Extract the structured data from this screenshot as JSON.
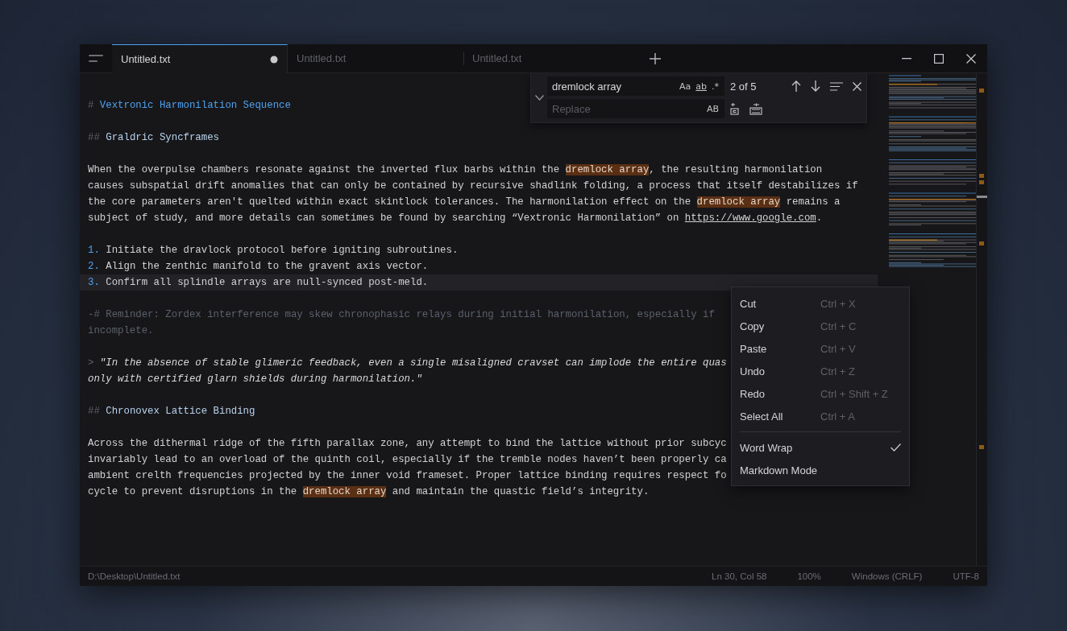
{
  "tabs": [
    {
      "label": "Untitled.txt",
      "selected": true,
      "modified": true
    },
    {
      "label": "Untitled.txt",
      "selected": false,
      "modified": false
    },
    {
      "label": "Untitled.txt",
      "selected": false,
      "modified": false
    }
  ],
  "find": {
    "query": "dremlock array",
    "toggles": [
      "Aa",
      "ab",
      ".*"
    ],
    "count": "2 of 5",
    "replace": {
      "placeholder": "Replace",
      "toggle": "AB"
    }
  },
  "editor": {
    "lines": [
      {
        "kind": "h1",
        "marker": "#",
        "text": "Vextronic Harmonilation Sequence",
        "current": false
      },
      {
        "kind": "blank",
        "current": false
      },
      {
        "kind": "h2",
        "marker": "##",
        "text": "Graldric Syncframes",
        "current": false
      },
      {
        "kind": "blank",
        "current": false
      },
      {
        "kind": "text",
        "current": false,
        "segments": [
          {
            "text": "When the overpulse chambers resonate against the inverted flux barbs within the ",
            "kind": "plain"
          },
          {
            "text": "dremlock array",
            "kind": "match"
          },
          {
            "text": ", the resulting harmonilation",
            "kind": "plain"
          }
        ]
      },
      {
        "kind": "text",
        "current": false,
        "segments": [
          {
            "text": "causes subspatial drift anomalies that can only be contained by recursive shadlink folding, a process that itself destabilizes if",
            "kind": "plain"
          }
        ]
      },
      {
        "kind": "text",
        "current": false,
        "segments": [
          {
            "text": "the core parameters aren't quelted within exact skintlock tolerances. The harmonilation effect on the ",
            "kind": "plain"
          },
          {
            "text": "dremlock array",
            "kind": "match"
          },
          {
            "text": " remains a",
            "kind": "plain"
          }
        ]
      },
      {
        "kind": "text",
        "current": false,
        "segments": [
          {
            "text": "subject of study, and more details can sometimes be found by searching “Vextronic Harmonilation” on ",
            "kind": "plain"
          },
          {
            "text": "https://www.google.com",
            "kind": "link"
          },
          {
            "text": ".",
            "kind": "plain"
          }
        ]
      },
      {
        "kind": "blank",
        "current": false
      },
      {
        "kind": "list",
        "marker": "1.",
        "text": "Initiate the dravlock protocol before igniting subroutines.",
        "current": false
      },
      {
        "kind": "list",
        "marker": "2.",
        "text": "Align the zenthic manifold to the gravent axis vector.",
        "current": false
      },
      {
        "kind": "list",
        "marker": "3.",
        "text": "Confirm all splindle arrays are null-synced post-meld.",
        "current": true
      },
      {
        "kind": "blank",
        "current": false
      },
      {
        "kind": "comment",
        "marker": "-#",
        "text": "Reminder: Zordex interference may skew chronophasic relays during initial harmonilation, especially if",
        "current": false
      },
      {
        "kind": "comment",
        "text": "incomplete.",
        "current": false
      },
      {
        "kind": "blank",
        "current": false
      },
      {
        "kind": "quote",
        "marker": ">",
        "text": "\"In the absence of stable glimeric feedback, even a single misaligned cravset can implode the entire quas",
        "current": false
      },
      {
        "kind": "quote",
        "text": "only with certified glarn shields during harmonilation.\"",
        "current": false
      },
      {
        "kind": "blank",
        "current": false
      },
      {
        "kind": "h2",
        "marker": "##",
        "text": "Chronovex Lattice Binding",
        "current": false
      },
      {
        "kind": "blank",
        "current": false
      },
      {
        "kind": "text",
        "current": false,
        "segments": [
          {
            "text": "Across the dithermal ridge of the fifth parallax zone, any attempt to bind the lattice without prior subcyc",
            "kind": "plain"
          }
        ]
      },
      {
        "kind": "text",
        "current": false,
        "segments": [
          {
            "text": "invariably lead to an overload of the quinth coil, especially if the tremble nodes haven’t been properly ca",
            "kind": "plain"
          }
        ]
      },
      {
        "kind": "text",
        "current": false,
        "segments": [
          {
            "text": "ambient crelth frequencies projected by the inner void frameset. Proper lattice binding requires respect fo",
            "kind": "plain"
          }
        ]
      },
      {
        "kind": "text",
        "current": false,
        "segments": [
          {
            "text": "cycle to prevent disruptions in the ",
            "kind": "plain"
          },
          {
            "text": "dremlock array",
            "kind": "match"
          },
          {
            "text": " and maintain the quastic field’s integrity.",
            "kind": "plain"
          }
        ]
      }
    ]
  },
  "context_menu": {
    "items": [
      {
        "kind": "command",
        "label": "Cut",
        "shortcut": "Ctrl + X"
      },
      {
        "kind": "command",
        "label": "Copy",
        "shortcut": "Ctrl + C"
      },
      {
        "kind": "command",
        "label": "Paste",
        "shortcut": "Ctrl + V"
      },
      {
        "kind": "command",
        "label": "Undo",
        "shortcut": "Ctrl + Z"
      },
      {
        "kind": "command",
        "label": "Redo",
        "shortcut": "Ctrl + Shift + Z"
      },
      {
        "kind": "command",
        "label": "Select All",
        "shortcut": "Ctrl + A"
      },
      {
        "kind": "separator"
      },
      {
        "kind": "toggle",
        "label": "Word Wrap",
        "checked": true
      },
      {
        "kind": "toggle",
        "label": "Markdown Mode",
        "checked": false
      }
    ]
  },
  "status_bar": {
    "path": "D:\\Desktop\\Untitled.txt",
    "position": "Ln 30, Col 58",
    "zoom": "100%",
    "line_ending": "Windows (CRLF)",
    "encoding": "UTF-8"
  }
}
